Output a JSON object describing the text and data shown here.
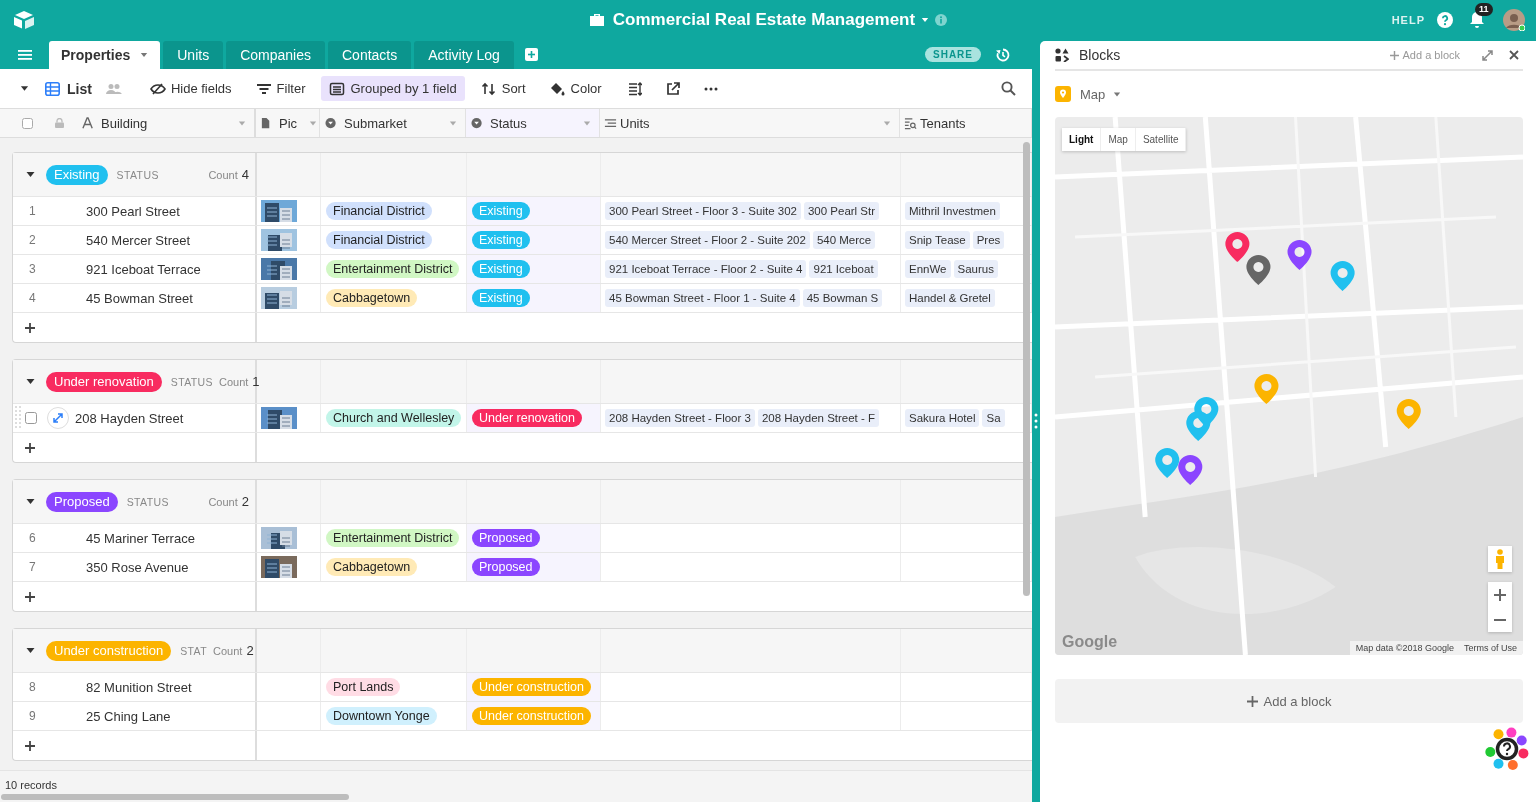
{
  "app": {
    "title": "Commercial Real Estate Management",
    "help": "HELP",
    "notifications": "11"
  },
  "tabs": [
    {
      "label": "Properties",
      "selected": true
    },
    {
      "label": "Units",
      "selected": false
    },
    {
      "label": "Companies",
      "selected": false
    },
    {
      "label": "Contacts",
      "selected": false
    },
    {
      "label": "Activity Log",
      "selected": false
    }
  ],
  "share": "SHARE",
  "toolbar": {
    "view": "List",
    "buttons": [
      {
        "label": "Hide fields",
        "kind": "hide",
        "active": false
      },
      {
        "label": "Filter",
        "kind": "filter",
        "active": false
      },
      {
        "label": "Grouped by 1 field",
        "kind": "group",
        "active": true
      },
      {
        "label": "Sort",
        "kind": "sort",
        "active": false
      },
      {
        "label": "Color",
        "kind": "color",
        "active": false
      }
    ]
  },
  "columns": [
    {
      "label": "Building",
      "kind": "primary",
      "menu": true
    },
    {
      "label": "Pic",
      "kind": "attachment",
      "menu": true
    },
    {
      "label": "Submarket",
      "kind": "select",
      "menu": true
    },
    {
      "label": "Status",
      "kind": "select",
      "menu": true
    },
    {
      "label": "Units",
      "kind": "link",
      "menu": true
    },
    {
      "label": "Tenants",
      "kind": "lookup",
      "menu": false
    }
  ],
  "groups": [
    {
      "label": "Existing",
      "color": "#20c0ef",
      "field": "STATUS",
      "count_label": "Count",
      "count": "4",
      "rows": [
        {
          "number": "1",
          "hovered": false,
          "building": "300 Pearl Street",
          "pic": {
            "kind": "picture"
          },
          "submarket": {
            "label": "Financial District",
            "color": "#d0e0fc"
          },
          "status": {
            "label": "Existing",
            "color": "#20c0ef"
          },
          "units": [
            "300 Pearl Street - Floor 3 - Suite 302",
            "300 Pearl Str"
          ],
          "tenants": [
            "Mithril Investmen"
          ]
        },
        {
          "number": "2",
          "hovered": false,
          "building": "540 Mercer Street",
          "pic": {
            "kind": "picture"
          },
          "submarket": {
            "label": "Financial District",
            "color": "#d0e0fc"
          },
          "status": {
            "label": "Existing",
            "color": "#20c0ef"
          },
          "units": [
            "540 Mercer Street - Floor 2 - Suite 202",
            "540 Merce"
          ],
          "tenants": [
            "Snip Tease",
            "Pres"
          ]
        },
        {
          "number": "3",
          "hovered": false,
          "building": "921 Iceboat Terrace",
          "pic": {
            "kind": "picture"
          },
          "submarket": {
            "label": "Entertainment District",
            "color": "#d1f7c4"
          },
          "status": {
            "label": "Existing",
            "color": "#20c0ef"
          },
          "units": [
            "921 Iceboat Terrace - Floor 2 - Suite 4",
            "921 Iceboat"
          ],
          "tenants": [
            "EnnWe",
            "Saurus"
          ]
        },
        {
          "number": "4",
          "hovered": false,
          "building": "45 Bowman Street",
          "pic": {
            "kind": "picture"
          },
          "submarket": {
            "label": "Cabbagetown",
            "color": "#ffeab6"
          },
          "status": {
            "label": "Existing",
            "color": "#20c0ef"
          },
          "units": [
            "45 Bowman Street - Floor 1 - Suite 4",
            "45 Bowman S"
          ],
          "tenants": [
            "Handel & Gretel"
          ]
        }
      ]
    },
    {
      "label": "Under renovation",
      "color": "#f82b60",
      "field": "STATUS",
      "count_label": "Count",
      "count": "1",
      "rows": [
        {
          "hovered": true,
          "building": "208 Hayden Street",
          "pic": {
            "kind": "picture"
          },
          "submarket": {
            "label": "Church and Wellesley",
            "color": "#c2f5e9"
          },
          "status": {
            "label": "Under renovation",
            "color": "#f82b60"
          },
          "units": [
            "208 Hayden Street - Floor 3",
            "208 Hayden Street - F"
          ],
          "tenants": [
            "Sakura Hotel",
            "Sa"
          ]
        }
      ]
    },
    {
      "label": "Proposed",
      "color": "#8b46ff",
      "field": "STATUS",
      "count_label": "Count",
      "count": "2",
      "rows": [
        {
          "number": "6",
          "hovered": false,
          "building": "45 Mariner Terrace",
          "pic": {
            "kind": "picture"
          },
          "submarket": {
            "label": "Entertainment District",
            "color": "#d1f7c4"
          },
          "status": {
            "label": "Proposed",
            "color": "#8b46ff"
          },
          "units": [],
          "tenants": []
        },
        {
          "number": "7",
          "hovered": false,
          "building": "350 Rose Avenue",
          "pic": {
            "kind": "picture"
          },
          "submarket": {
            "label": "Cabbagetown",
            "color": "#ffeab6"
          },
          "status": {
            "label": "Proposed",
            "color": "#8b46ff"
          },
          "units": [],
          "tenants": []
        }
      ]
    },
    {
      "label": "Under construction",
      "color": "#fcb400",
      "field": "STAT",
      "count_label": "Count",
      "count": "2",
      "rows": [
        {
          "number": "8",
          "hovered": false,
          "building": "82 Munition Street",
          "submarket": {
            "label": "Port Lands",
            "color": "#ffdce5"
          },
          "status": {
            "label": "Under construction",
            "color": "#fcb400"
          },
          "units": [],
          "tenants": []
        },
        {
          "number": "9",
          "hovered": false,
          "building": "25 Ching Lane",
          "submarket": {
            "label": "Downtown Yonge",
            "color": "#d0f0fd"
          },
          "status": {
            "label": "Under construction",
            "color": "#fcb400"
          },
          "units": [],
          "tenants": []
        }
      ]
    }
  ],
  "footer": {
    "records": "10 records"
  },
  "blocks": {
    "title": "Blocks",
    "add_link": "Add a block",
    "block": {
      "title": "Map",
      "map": {
        "kind": "picture"
      },
      "map_types": [
        {
          "label": "Light",
          "selected": true
        },
        {
          "label": "Map",
          "selected": false
        },
        {
          "label": "Satellite",
          "selected": false
        }
      ],
      "logo": "Google",
      "attribution": "Map data ©2018 Google",
      "terms": "Terms of Use"
    },
    "add_button": "Add a block"
  }
}
